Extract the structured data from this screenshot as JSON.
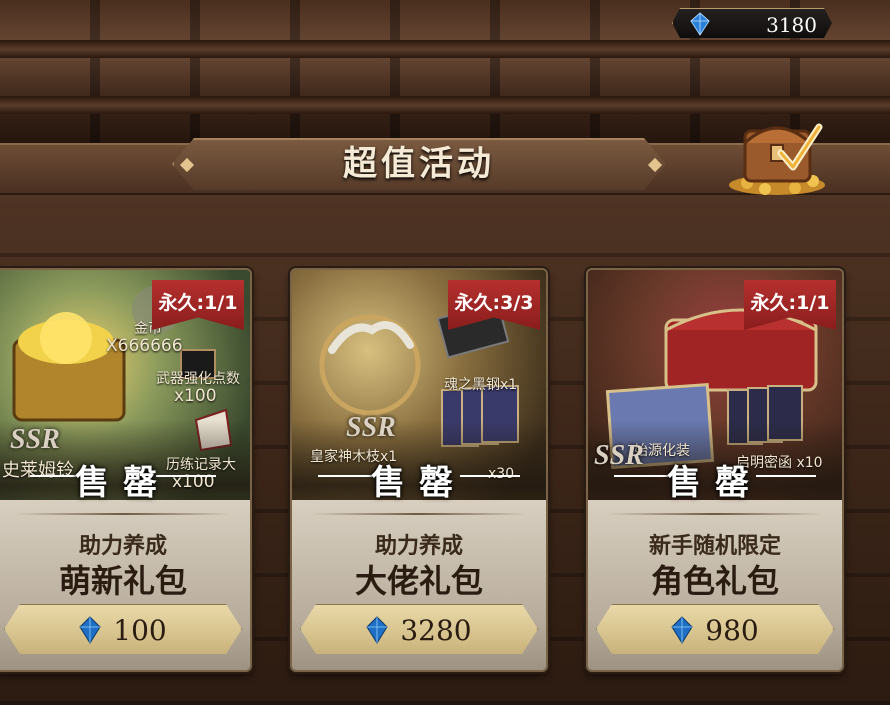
{
  "currency": {
    "icon": "blue-gem-icon",
    "amount": "3180"
  },
  "header": {
    "title": "超值活动"
  },
  "cards": [
    {
      "limit": "永久:1/1",
      "sold": "售罄",
      "category": "助力养成",
      "name": "萌新礼包",
      "price": "100",
      "items": [
        {
          "label": "金币",
          "qty": "X666666"
        },
        {
          "label": "武器强化点数",
          "qty": "x100"
        },
        {
          "label": "历练记录大",
          "qty": "x100"
        }
      ],
      "badge": "SSR",
      "badge_caption": "史莱姆铃"
    },
    {
      "limit": "永久:3/3",
      "sold": "售罄",
      "category": "助力养成",
      "name": "大佬礼包",
      "price": "3280",
      "items": [
        {
          "label": "魂之黑钢x1"
        },
        {
          "label": "皇家神木枝x1"
        },
        {
          "label": "x30"
        }
      ],
      "badge": "SSR"
    },
    {
      "limit": "永久:1/1",
      "sold": "售罄",
      "category": "新手随机限定",
      "name": "角色礼包",
      "price": "980",
      "items": [
        {
          "label": "始源化装"
        },
        {
          "label": "启明密函 x10"
        }
      ],
      "badge": "SSR"
    }
  ],
  "colors": {
    "ribbon": "#b5302e",
    "gem": "#2a7fd6",
    "gold": "#e3c48f"
  }
}
